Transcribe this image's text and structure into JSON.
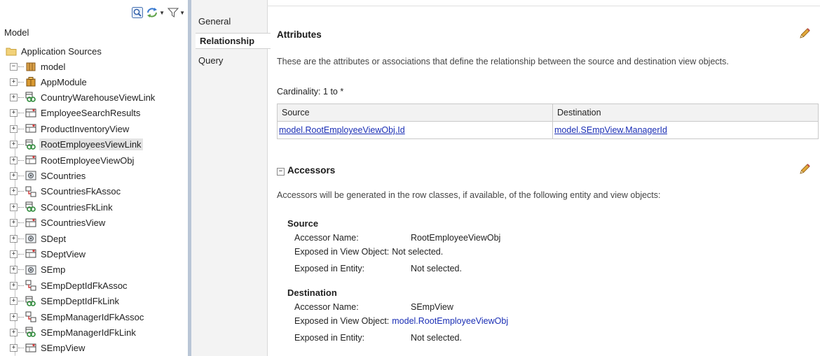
{
  "tree": {
    "root_label": "Model",
    "app_sources_label": "Application Sources",
    "package_label": "model",
    "items": [
      {
        "label": "AppModule",
        "icon": "app-module-icon"
      },
      {
        "label": "CountryWarehouseViewLink",
        "icon": "view-link-icon"
      },
      {
        "label": "EmployeeSearchResults",
        "icon": "view-object-icon"
      },
      {
        "label": "ProductInventoryView",
        "icon": "view-object-icon"
      },
      {
        "label": "RootEmployeesViewLink",
        "icon": "view-link-icon",
        "selected": true
      },
      {
        "label": "RootEmployeeViewObj",
        "icon": "view-object-icon"
      },
      {
        "label": "SCountries",
        "icon": "entity-object-icon"
      },
      {
        "label": "SCountriesFkAssoc",
        "icon": "association-icon"
      },
      {
        "label": "SCountriesFkLink",
        "icon": "view-link-icon"
      },
      {
        "label": "SCountriesView",
        "icon": "view-object-icon"
      },
      {
        "label": "SDept",
        "icon": "entity-object-icon"
      },
      {
        "label": "SDeptView",
        "icon": "view-object-icon"
      },
      {
        "label": "SEmp",
        "icon": "entity-object-icon"
      },
      {
        "label": "SEmpDeptIdFkAssoc",
        "icon": "association-icon"
      },
      {
        "label": "SEmpDeptIdFkLink",
        "icon": "view-link-icon"
      },
      {
        "label": "SEmpManagerIdFkAssoc",
        "icon": "association-icon"
      },
      {
        "label": "SEmpManagerIdFkLink",
        "icon": "view-link-icon"
      },
      {
        "label": "SEmpView",
        "icon": "view-object-icon"
      }
    ]
  },
  "tabs": [
    {
      "label": "General",
      "active": false
    },
    {
      "label": "Relationship",
      "active": true
    },
    {
      "label": "Query",
      "active": false
    }
  ],
  "attributes": {
    "title": "Attributes",
    "description": "These are the attributes or associations that define the relationship between the source and destination view objects.",
    "cardinality_label": "Cardinality:",
    "cardinality_value": "1 to *",
    "table": {
      "columns": [
        "Source",
        "Destination"
      ],
      "rows": [
        [
          "model.RootEmployeeViewObj.Id",
          "model.SEmpView.ManagerId"
        ]
      ]
    }
  },
  "accessors": {
    "collapse_glyph": "−",
    "title": "Accessors",
    "description": "Accessors will be generated in the row classes, if available, of the following entity and view objects:",
    "source": {
      "title": "Source",
      "accessor_name_label": "Accessor Name:",
      "accessor_name_value": "RootEmployeeViewObj",
      "exposed_view_label": "Exposed in View Object:",
      "exposed_view_value": "Not selected.",
      "exposed_entity_label": "Exposed in Entity:",
      "exposed_entity_value": "Not selected."
    },
    "destination": {
      "title": "Destination",
      "accessor_name_label": "Accessor Name:",
      "accessor_name_value": "SEmpView",
      "exposed_view_label": "Exposed in View Object:",
      "exposed_view_value": "model.RootEmployeeViewObj",
      "exposed_entity_label": "Exposed in Entity:",
      "exposed_entity_value": "Not selected."
    }
  },
  "colors": {
    "link": "#1b2fb5",
    "splitter": "#b9c6d6",
    "tab_column_bg": "#f3f3f3",
    "selected_row_bg": "#e4e4e4"
  }
}
